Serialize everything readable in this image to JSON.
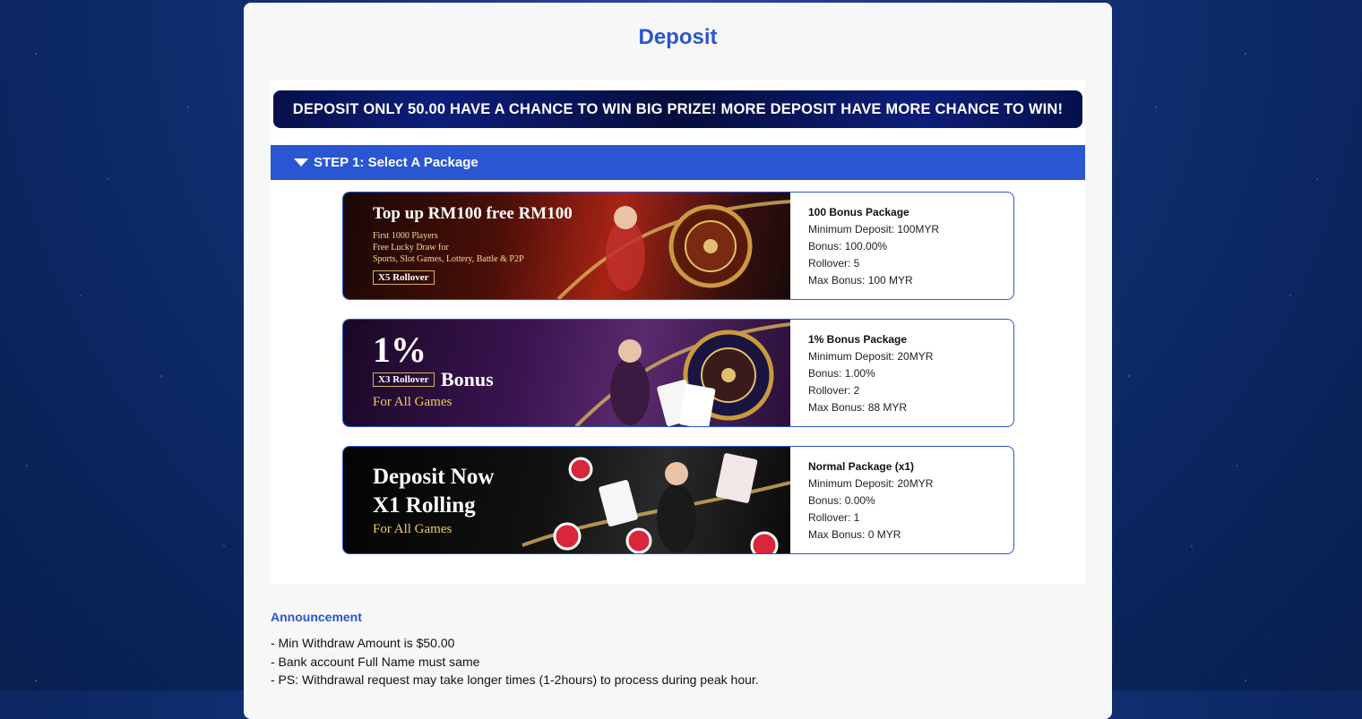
{
  "page": {
    "title": "Deposit"
  },
  "promo_banner": {
    "text": "DEPOSIT ONLY 50.00 HAVE A CHANCE TO WIN BIG PRIZE! MORE DEPOSIT HAVE MORE CHANCE TO WIN!"
  },
  "step1": {
    "label": "STEP 1: Select A Package",
    "icon": "caret-down-icon"
  },
  "packages": [
    {
      "banner": {
        "title": "Top up RM100 free RM100",
        "lines": [
          "First 1000 Players",
          "Free Lucky Draw for",
          "Sports, Slot Games, Lottery, Battle & P2P"
        ],
        "rollover": "X5 Rollover"
      },
      "name": "100 Bonus Package",
      "min_deposit": "Minimum Deposit: 100MYR",
      "bonus": "Bonus: 100.00%",
      "rollover": "Rollover: 5",
      "max_bonus": "Max Bonus: 100 MYR",
      "colors": {
        "bg_from": "#1c0a06",
        "bg_to": "#b2281a"
      }
    },
    {
      "banner": {
        "big": "1%",
        "rollover": "X3 Rollover",
        "word": "Bonus",
        "sub": "For All Games"
      },
      "name": "1% Bonus Package",
      "min_deposit": "Minimum Deposit: 20MYR",
      "bonus": "Bonus: 1.00%",
      "rollover": "Rollover: 2",
      "max_bonus": "Max Bonus: 88 MYR",
      "colors": {
        "bg_from": "#1a0a2a",
        "bg_to": "#5a2a6e"
      }
    },
    {
      "banner": {
        "line1": "Deposit Now",
        "line2": "X1 Rolling",
        "sub": "For All Games"
      },
      "name": "Normal Package (x1)",
      "min_deposit": "Minimum Deposit: 20MYR",
      "bonus": "Bonus: 0.00%",
      "rollover": "Rollover: 1",
      "max_bonus": "Max Bonus: 0 MYR",
      "colors": {
        "bg_from": "#050505",
        "bg_to": "#2a2a2a"
      }
    }
  ],
  "announcement": {
    "title": "Announcement",
    "lines": [
      "- Min Withdraw Amount is $50.00",
      "- Bank account Full Name must same",
      "- PS: Withdrawal request may take longer times (1-2hours) to process during peak hour."
    ]
  }
}
